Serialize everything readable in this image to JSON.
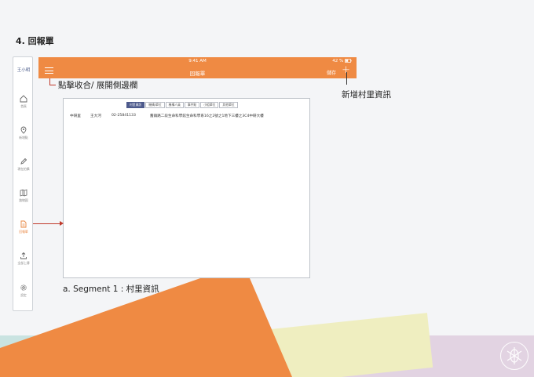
{
  "section_title": "4. 回報單",
  "sidebar": {
    "user": "王小明",
    "items": [
      {
        "label": "首頁",
        "icon": "home-icon"
      },
      {
        "label": "新增點",
        "icon": "location-pin-icon"
      },
      {
        "label": "現在拍攝",
        "icon": "pencil-icon"
      },
      {
        "label": "路線圖",
        "icon": "map-icon"
      },
      {
        "label": "回報單",
        "icon": "document-icon",
        "active": true
      },
      {
        "label": "全部上傳",
        "icon": "upload-icon"
      },
      {
        "label": "設定",
        "icon": "gear-icon"
      }
    ]
  },
  "topbar": {
    "time": "9:41 AM",
    "battery": "42 %",
    "title": "回報單",
    "save_label": "儲存",
    "add_label": "+",
    "background": "#ef8a43"
  },
  "tabs": [
    "村里資訊",
    "機構/單位",
    "機構人員",
    "事件點",
    "小組單位",
    "其他單位"
  ],
  "row": {
    "name": "中研里",
    "person": "王大河",
    "phone": "02-25841133",
    "address": "舊鎮路二段生命科學館生命科學系16之2號之1地下三樓之3C4中研大樓"
  },
  "annotations": {
    "menu_hint": "點擊收合/ 展開側邊欄",
    "add_hint": "新增村里資訊",
    "segment_caption": "a. Segment 1 : 村里資訊"
  },
  "colors": {
    "accent": "#ef8a43",
    "tab_active": "#4d5a8c",
    "pointer": "#c0392b"
  }
}
